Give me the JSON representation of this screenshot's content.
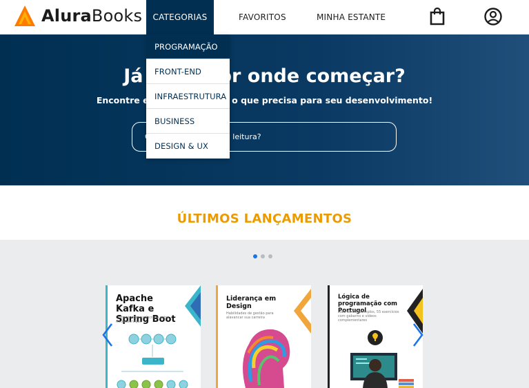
{
  "header": {
    "logo_bold": "Alura",
    "logo_regular": "Books",
    "nav": [
      {
        "label": "CATEGORIAS"
      },
      {
        "label": "FAVORITOS"
      },
      {
        "label": "MINHA ESTANTE"
      }
    ],
    "icons": {
      "bag": "shopping-bag-icon",
      "user": "user-circle-icon"
    }
  },
  "dropdown": {
    "items": [
      {
        "label": "PROGRAMAÇÃO",
        "active": true
      },
      {
        "label": "FRONT-END"
      },
      {
        "label": "INFRAESTRUTURA"
      },
      {
        "label": "BUSINESS"
      },
      {
        "label": "DESIGN & UX"
      }
    ]
  },
  "banner": {
    "title": "Já sabe por onde começar?",
    "subtitle": "Encontre em nossa estante o que precisa para seu desenvolvimento!",
    "search_placeholder": "Qual será sua próxima leitura?"
  },
  "section": {
    "title": "ÚLTIMOS LANÇAMENTOS"
  },
  "carousel": {
    "dots": 3,
    "active_dot": 0,
    "books": [
      {
        "title": "Apache Kafka e Spring Boot",
        "subtitle": "Comunicação assíncrona entre microsserviços"
      },
      {
        "title": "Liderança em Design",
        "subtitle": "Habilidades de gestão para alavancar sua carreira"
      },
      {
        "title": "Lógica de programação com Portugol",
        "subtitle": "Mais de 80 exemplos, 55 exercícios com gabarito e vídeos complementares"
      }
    ]
  },
  "colors": {
    "primary": "#002f52",
    "accent": "#eb9b00",
    "carousel_bg": "#ebeced",
    "arrow": "#1875e8"
  }
}
